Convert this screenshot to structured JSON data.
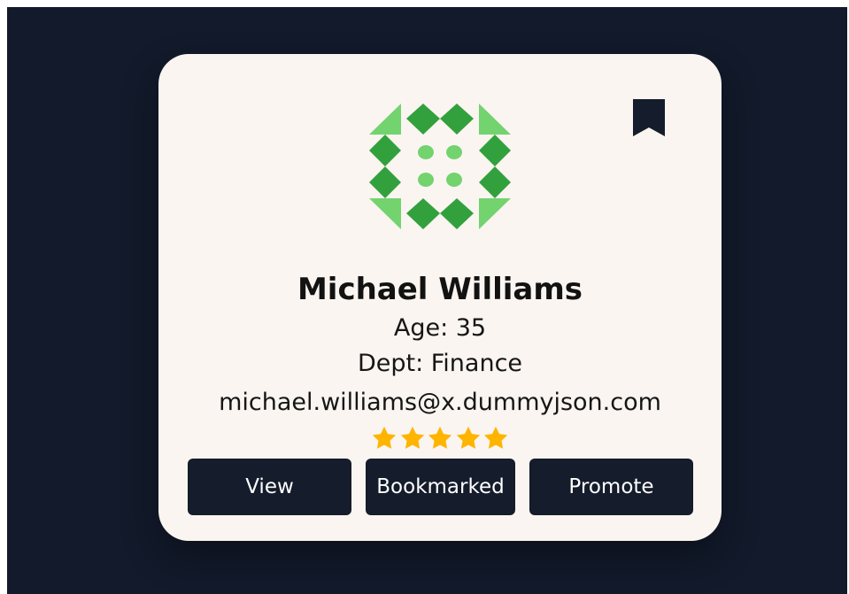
{
  "profile": {
    "name": "Michael Williams",
    "age": "Age: 35",
    "department": "Dept: Finance",
    "email": "michael.williams@x.dummyjson.com",
    "rating": 5,
    "rating_color": "#ffb400"
  },
  "icons": {
    "bookmark": "bookmark-icon",
    "avatar": "pattern-avatar-icon",
    "star": "star-icon"
  },
  "actions": {
    "view": "View",
    "bookmarked": "Bookmarked",
    "promote": "Promote"
  },
  "colors": {
    "background": "#121a2b",
    "card": "#faf5f0",
    "button": "#151c2b",
    "avatar_dark_green": "#32a13d",
    "avatar_light_green": "#73d36f"
  }
}
